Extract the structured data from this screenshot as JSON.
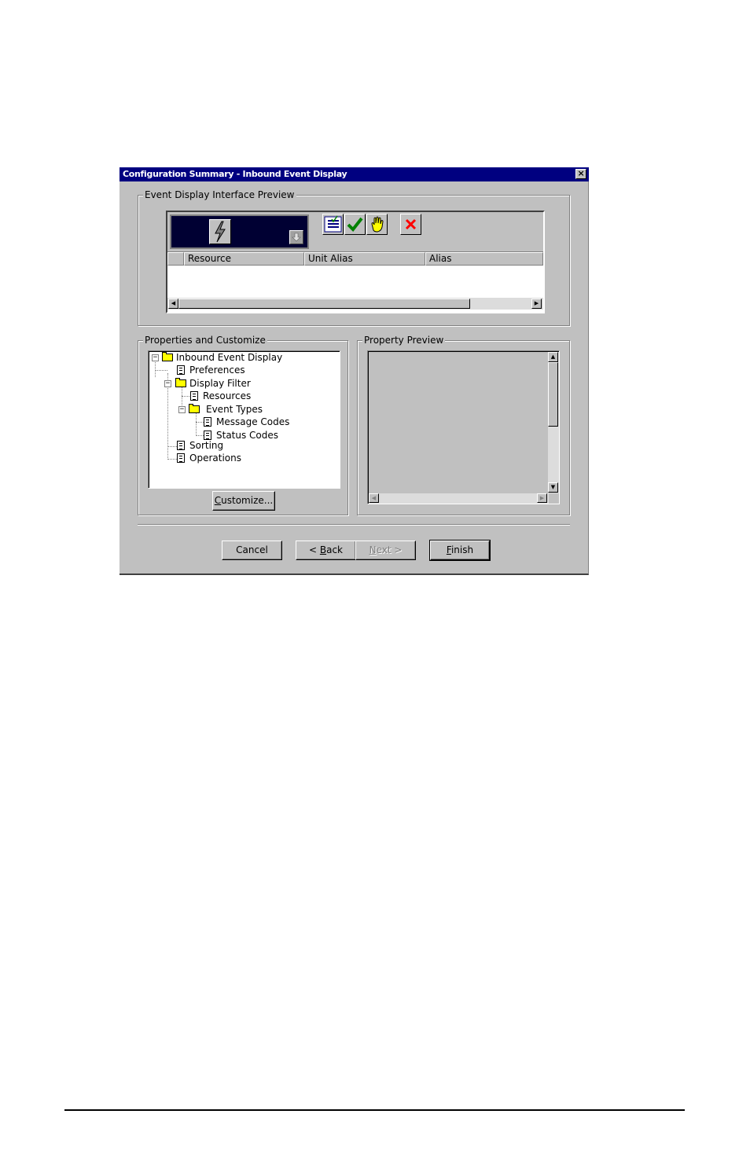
{
  "window": {
    "title": "Configuration Summary - Inbound Event  Display",
    "close_glyph": "×"
  },
  "preview_group": {
    "label": "Event Display Interface Preview",
    "columns": [
      "Resource",
      "Unit Alias",
      "Alias"
    ],
    "toolbar_icons": [
      "list-check-icon",
      "checkmark-icon",
      "hand-icon",
      "delete-x-icon"
    ],
    "accent_color": "#000080"
  },
  "properties_group": {
    "label": "Properties and Customize",
    "tree": [
      {
        "label": "Inbound Event  Display",
        "type": "folder",
        "expanded": true
      },
      {
        "label": "Preferences",
        "type": "doc"
      },
      {
        "label": "Display Filter",
        "type": "folder",
        "expanded": true
      },
      {
        "label": "Resources",
        "type": "doc"
      },
      {
        "label": "Event Types",
        "type": "folder",
        "expanded": true
      },
      {
        "label": "Message Codes",
        "type": "doc"
      },
      {
        "label": "Status Codes",
        "type": "doc"
      },
      {
        "label": "Sorting",
        "type": "doc"
      },
      {
        "label": "Operations",
        "type": "doc"
      }
    ],
    "customize_button": "Customize...",
    "customize_hotkey": "C",
    "customize_rest": "ustomize..."
  },
  "property_preview_group": {
    "label": "Property Preview"
  },
  "buttons": {
    "cancel": "Cancel",
    "back_prefix": "< ",
    "back_hotkey": "B",
    "back_rest": "ack",
    "next_hotkey": "N",
    "next_rest": "ext >",
    "finish_hotkey": "F",
    "finish_rest": "inish"
  }
}
